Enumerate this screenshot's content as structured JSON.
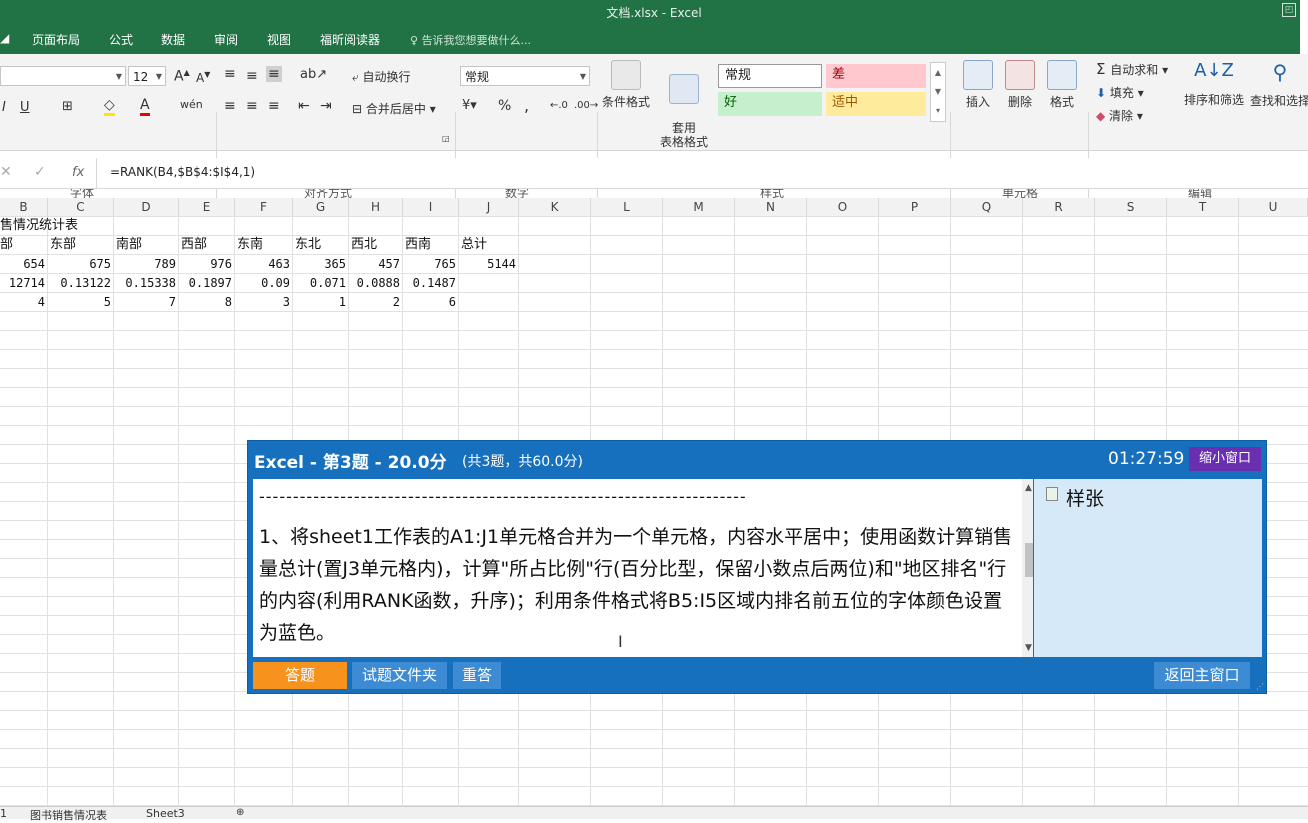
{
  "window": {
    "title": "文档.xlsx - Excel"
  },
  "ribbon_tabs": [
    "页面布局",
    "公式",
    "数据",
    "审阅",
    "视图",
    "福昕阅读器"
  ],
  "tell_me": "告诉我您想要做什么...",
  "font": {
    "size": "12",
    "bold": "I",
    "underline": "U",
    "group_label": "字体"
  },
  "alignment": {
    "wrap": "自动换行",
    "merge": "合并后居中",
    "group_label": "对齐方式"
  },
  "number": {
    "format": "常规",
    "percent": "%",
    "comma": ",",
    "group_label": "数字"
  },
  "styles": {
    "conditional": "条件格式",
    "table_format": "套用\n表格格式",
    "normal": "常规",
    "bad": "差",
    "good": "好",
    "neutral": "适中",
    "group_label": "样式",
    "colors": {
      "bad_bg": "#ffc7ce",
      "good_bg": "#c6efce",
      "neutral_bg": "#ffeb9c"
    }
  },
  "cells_group": {
    "insert": "插入",
    "delete": "删除",
    "format": "格式",
    "group_label": "单元格"
  },
  "editing": {
    "autosum": "自动求和",
    "fill": "填充",
    "clear": "清除",
    "sort": "排序和筛选",
    "find": "查找和选择",
    "group_label": "编辑"
  },
  "formula_bar": {
    "formula": "=RANK(B4,$B$4:$I$4,1)",
    "fx": "fx"
  },
  "columns": [
    "B",
    "C",
    "D",
    "E",
    "F",
    "G",
    "H",
    "I",
    "J",
    "K",
    "L",
    "M",
    "N",
    "O",
    "P",
    "Q",
    "R",
    "S",
    "T",
    "U"
  ],
  "sheet": {
    "title_row": "售情况统计表",
    "headers": [
      "部",
      "东部",
      "南部",
      "西部",
      "东南",
      "东北",
      "西北",
      "西南",
      "总计"
    ],
    "row4": [
      "654",
      "675",
      "789",
      "976",
      "463",
      "365",
      "457",
      "765",
      "5144"
    ],
    "row5": [
      "12714",
      "0.13122",
      "0.15338",
      "0.1897",
      "0.09",
      "0.071",
      "0.0888",
      "0.1487"
    ],
    "row6": [
      "4",
      "5",
      "7",
      "8",
      "3",
      "1",
      "2",
      "6"
    ]
  },
  "sheet_tabs": [
    "1",
    "图书销售情况表",
    "Sheet3"
  ],
  "dialog": {
    "title": "Excel - 第3题 - 20.0分",
    "subtitle": "(共3题，共60.0分)",
    "timer": "01:27:59",
    "shrink_button": "缩小窗口",
    "dashes": "------------------------------------------------------------------------",
    "question": "1、将sheet1工作表的A1:J1单元格合并为一个单元格，内容水平居中；使用函数计算销售量总计(置J3单元格内)，计算\"所占比例\"行(百分比型，保留小数点后两位)和\"地区排名\"行的内容(利用RANK函数，升序)；利用条件格式将B5:I5区域内排名前五位的字体颜色设置为蓝色。",
    "sample_label": "样张",
    "buttons": {
      "answer": "答题",
      "folder": "试题文件夹",
      "redo": "重答",
      "return": "返回主窗口"
    },
    "colors": {
      "frame": "#1670bd",
      "answer_btn": "#f7931d",
      "shrink_btn": "#6a2fb0"
    }
  }
}
